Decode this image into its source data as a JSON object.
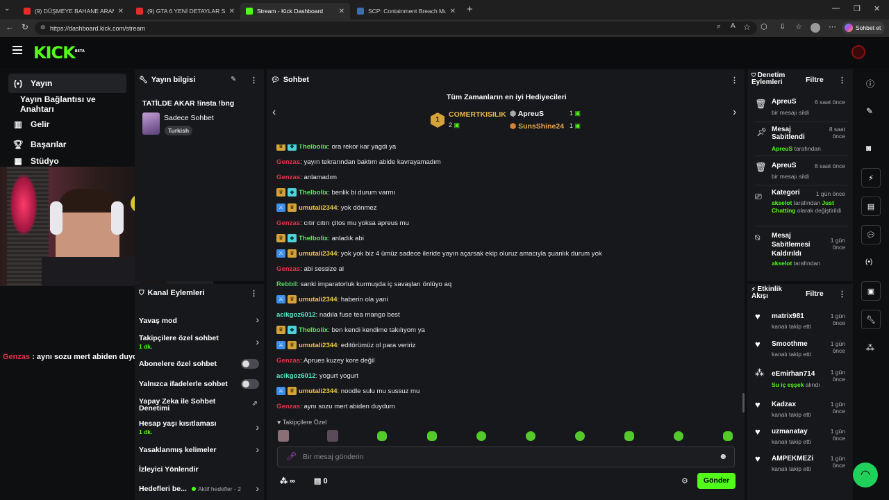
{
  "browser": {
    "tabs": [
      {
        "label": "(9) DÜŞMEYE BAHANE ARAMAK |"
      },
      {
        "label": "(9) GTA 6 YENİ DETAYLAR SIZDI! Y"
      },
      {
        "label": "Stream - Kick Dashboard"
      },
      {
        "label": "SCP: Containment Breach Multipla"
      }
    ],
    "url": "https://dashboard.kick.com/stream",
    "copilot_label": "Sohbet et"
  },
  "brand": {
    "logo": "KICK",
    "beta": "BETA"
  },
  "nav": {
    "items": [
      {
        "label": "Yayın"
      },
      {
        "label": "Yayın Bağlantısı ve Anahtarı"
      },
      {
        "label": "Gelir"
      },
      {
        "label": "Başarılar"
      },
      {
        "label": "Stüdyo"
      }
    ]
  },
  "overlay_chat": {
    "user": "Genzas",
    "text": " : aynı sozu mert abiden duydum"
  },
  "stream_info": {
    "title": "Yayın bilgisi",
    "stream_title": "TATİLDE AKAR !insta !bng",
    "category": "Sadece Sohbet",
    "tag": "Turkish"
  },
  "channel_actions": {
    "title": "Kanal Eylemleri",
    "items": [
      {
        "label": "Yavaş mod",
        "sub": ""
      },
      {
        "label": "Takipçilere özel sohbet",
        "sub": "1 dk."
      },
      {
        "label": "Abonelere özel sohbet",
        "sub": ""
      },
      {
        "label": "Yalnızca ifadelerle sohbet",
        "sub": ""
      },
      {
        "label": "Yapay Zeka ile Sohbet Denetimi",
        "sub": ""
      },
      {
        "label": "Hesap yaşı kısıtlaması",
        "sub": "1 dk."
      },
      {
        "label": "Yasaklanmış kelimeler",
        "sub": ""
      },
      {
        "label": "İzleyici Yönlendir",
        "sub": ""
      },
      {
        "label": "Hedefleri be...",
        "sub": "Aktif hedefler - 2"
      }
    ]
  },
  "chat": {
    "title": "Sohbet",
    "gifters_title": "Tüm Zamanların en iyi Hediyecileri",
    "gifters": [
      {
        "rank": "1",
        "name": "COMERTKISILIK",
        "count": "2"
      },
      {
        "name": "ApreuS",
        "count": "1"
      },
      {
        "name": "SunsShine24",
        "count": "1"
      }
    ],
    "messages": [
      {
        "user": "Thelbolix",
        "text": ": ora rekor kar yagdi ya",
        "color": "#5be85b"
      },
      {
        "user": "Genzas",
        "text": ": yayın tekrarından baktım abide kavrayamadım",
        "color": "#e0334b"
      },
      {
        "user": "Genzas",
        "text": ": anlamadım",
        "color": "#e0334b"
      },
      {
        "user": "Thelbolix",
        "text": ": benlik bi durum varmı",
        "color": "#5be85b"
      },
      {
        "user": "umutali2344",
        "text": ": yok dönmez",
        "color": "#e8c84a"
      },
      {
        "user": "Genzas",
        "text": ": cıtır cıtırı çitos mu yoksa apreus mu",
        "color": "#e0334b"
      },
      {
        "user": "Thelbolix",
        "text": ": anladık abi",
        "color": "#5be85b"
      },
      {
        "user": "umutali2344",
        "text": ": yok yok biz 4 ümüz sadece ileride yayın açarsak ekip oluruz amacıyla şuanlık durum yok",
        "color": "#e8c84a"
      },
      {
        "user": "Genzas",
        "text": ": abi sessize al",
        "color": "#e0334b"
      },
      {
        "user": "Rebbil",
        "text": ": sanki imparatorluk kurmuşda iç savaşları önlüyo aq",
        "color": "#4fd26b"
      },
      {
        "user": "umutali2344",
        "text": ": haberin ola yani",
        "color": "#e8c84a"
      },
      {
        "user": "acikgoz6012",
        "text": ": nadıla fuse tea mango best",
        "color": "#5be8c9"
      },
      {
        "user": "Thelbolix",
        "text": ": ben kendi kendime takılıyom ya",
        "color": "#5be85b"
      },
      {
        "user": "umutali2344",
        "text": ": editörümüz ol para veririz",
        "color": "#e8c84a"
      },
      {
        "user": "Genzas",
        "text": ": Aprues kuzey kore değil",
        "color": "#e0334b"
      },
      {
        "user": "acikgoz6012",
        "text": ": yogurt yogurt",
        "color": "#5be8c9"
      },
      {
        "user": "umutali2344",
        "text": ": noodle sulu mu sussuz mu",
        "color": "#e8c84a"
      },
      {
        "user": "Genzas",
        "text": ": aynı sozu mert abiden duydum",
        "color": "#e0334b"
      }
    ],
    "followers_only_label": "Takipçilere Özel",
    "input_placeholder": "Bir mesaj gönderin",
    "points_value": "∞",
    "viewers_value": "0",
    "send_label": "Gönder"
  },
  "mod_actions": {
    "title": "Denetim Eylemleri",
    "filter_label": "Filtre",
    "items": [
      {
        "title": "ApreuS",
        "time": "6 saat önce",
        "line1": "bir mesajı sildi",
        "line2": "",
        "line3": ""
      },
      {
        "title": "Mesaj Sabitlendi",
        "time": "8 saat önce",
        "line1": "ApreuS",
        "line2": " tarafından",
        "line3": ""
      },
      {
        "title": "ApreuS",
        "time": "8 saat önce",
        "line1": "bir mesajı sildi",
        "line2": "",
        "line3": ""
      },
      {
        "title": "Kategori",
        "time": "1 gün önce",
        "line1": "akselot",
        "line2": " tarafından ",
        "line3": "Just Chatting",
        "line4": " olarak değiştirildi"
      },
      {
        "title": "Mesaj Sabitlemesi Kaldırıldı",
        "time": "1 gün önce",
        "line1": "akselot",
        "line2": " tarafından",
        "line3": ""
      }
    ]
  },
  "activity": {
    "title": "Etkinlik Akışı",
    "filter_label": "Filtre",
    "items": [
      {
        "name": "matrix981",
        "time": "1 gün önce",
        "action": "kanalı takip etti",
        "icon": "heart-icon"
      },
      {
        "name": "Smoothme",
        "time": "1 gün önce",
        "action": "kanalı takip etti",
        "icon": "heart-icon"
      },
      {
        "name": "eEmirhan714",
        "time": "1 gün önce",
        "action_pre": "Su iç eşşek",
        "action": " alındı",
        "icon": "reward-icon"
      },
      {
        "name": "Kadzax",
        "time": "1 gün önce",
        "action": "kanalı takip etti",
        "icon": "heart-icon"
      },
      {
        "name": "uzmanatay",
        "time": "1 gün önce",
        "action": "kanalı takip etti",
        "icon": "heart-icon"
      },
      {
        "name": "AMPEKMEZi",
        "time": "1 gün önce",
        "action": "kanalı takip etti",
        "icon": "heart-icon"
      }
    ]
  },
  "colors": {
    "accent": "#53fc18",
    "panel": "#17181b",
    "background": "#0e0f11"
  }
}
